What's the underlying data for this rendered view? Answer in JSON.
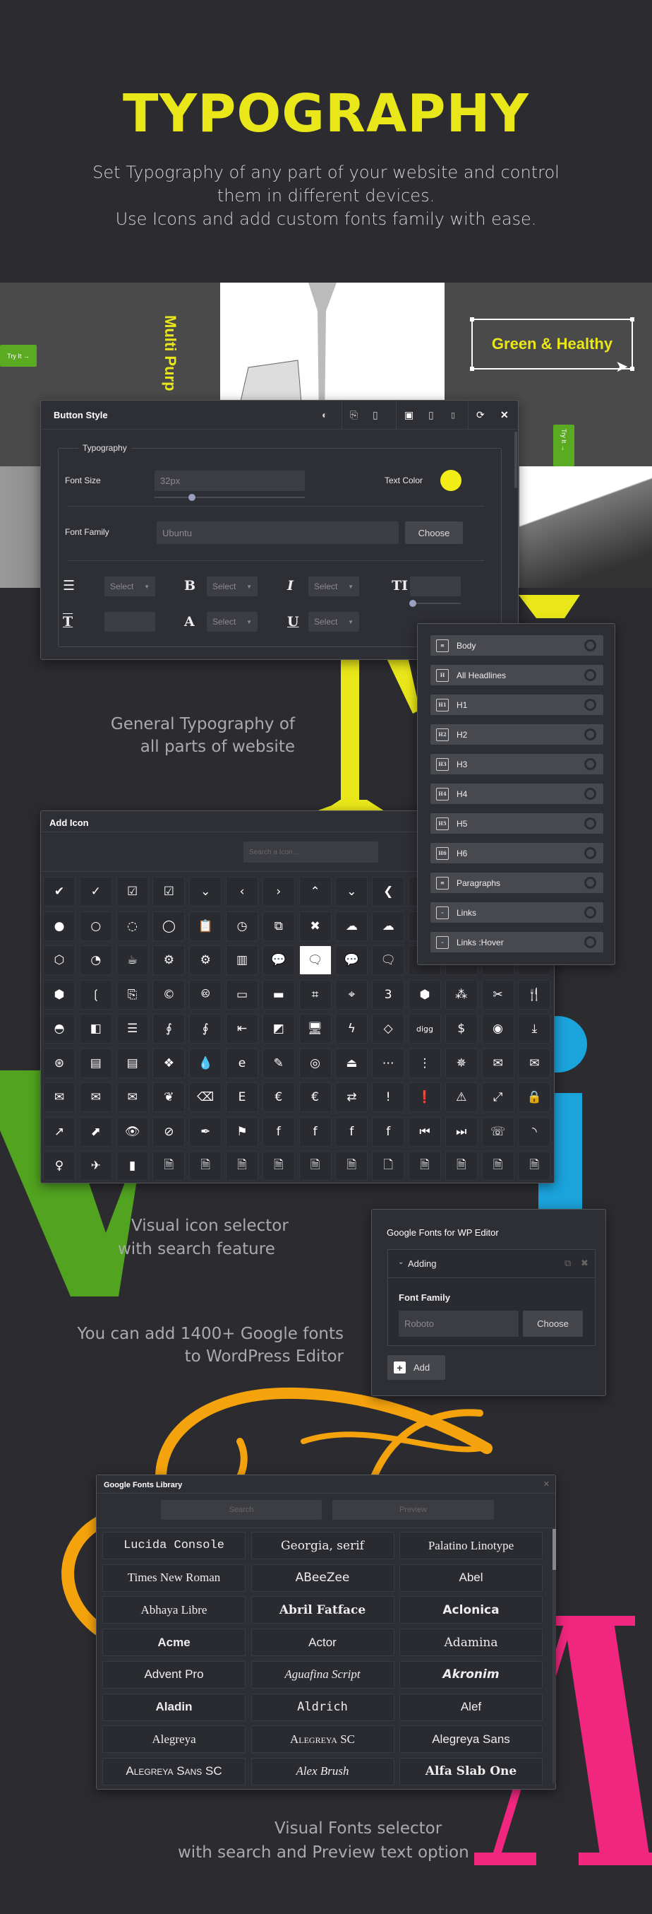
{
  "header": {
    "title": "TYPOGRAPHY",
    "subtitle_lines": [
      "Set Typography of any part of your website and control",
      "them in different devices.",
      "Use Icons and add custom fonts family with ease."
    ]
  },
  "colors": {
    "accent_yellow": "#e9e71a",
    "green": "#5aaa22",
    "blue": "#1ba3dc",
    "orange": "#f5a30d",
    "pink": "#f0267f",
    "background": "#2b2b30"
  },
  "hero": {
    "try_it_left": "Try It →",
    "vertical_text": "Multi Purp",
    "selected_text": "Green & Healthy",
    "try_it_vertical": "Try It →"
  },
  "button_style": {
    "title": "Button Style",
    "header_icons": [
      "contrast-icon",
      "copy-icon",
      "paste-icon",
      "desktop-icon",
      "tablet-icon",
      "mobile-icon",
      "refresh-icon",
      "close-icon"
    ],
    "fieldset_legend": "Typography",
    "font_size_label": "Font Size",
    "font_size_value": "32px",
    "font_size_slider": 0.25,
    "text_color_label": "Text Color",
    "text_color": "#f2ec17",
    "font_family_label": "Font Family",
    "font_family_value": "Ubuntu",
    "choose_label": "Choose",
    "row1": [
      {
        "icon": "line-height-icon",
        "value": "Select"
      },
      {
        "icon": "bold-icon",
        "value": "Select"
      },
      {
        "icon": "italic-icon",
        "value": "Select"
      },
      {
        "icon": "text-height-icon",
        "value": ""
      }
    ],
    "row2": [
      {
        "icon": "letter-spacing-icon",
        "value": ""
      },
      {
        "icon": "font-color-icon",
        "value": "Select"
      },
      {
        "icon": "underline-icon",
        "value": "Select"
      }
    ],
    "letter_slider": 0.05
  },
  "typography_list": {
    "items": [
      {
        "label": "Body",
        "icon": "body"
      },
      {
        "label": "All Headlines",
        "icon": "H"
      },
      {
        "label": "H1",
        "icon": "H1"
      },
      {
        "label": "H2",
        "icon": "H2"
      },
      {
        "label": "H3",
        "icon": "H3"
      },
      {
        "label": "H4",
        "icon": "H4"
      },
      {
        "label": "H5",
        "icon": "H5"
      },
      {
        "label": "H6",
        "icon": "H6"
      },
      {
        "label": "Paragraphs",
        "icon": "paragraph"
      },
      {
        "label": "Links",
        "icon": "link"
      },
      {
        "label": "Links :Hover",
        "icon": "link"
      }
    ]
  },
  "captions": {
    "general": [
      "General Typography of",
      "all parts of website"
    ],
    "icon": [
      "Visual icon selector",
      "with search feature"
    ],
    "google": [
      "You can add 1400+ Google fonts",
      "to WordPress Editor"
    ],
    "fonts": [
      "Visual Fonts selector",
      "with search and Preview text option"
    ]
  },
  "icon_selector": {
    "title": "Add Icon",
    "search_placeholder": "Search a Icon...",
    "selected_index": 35,
    "icons": [
      "check-circle",
      "check-circle-o",
      "check-square",
      "check-square-o",
      "chevron-circle-down",
      "chevron-circle-left",
      "chevron-circle-right",
      "chevron-circle-up",
      "chevron-down",
      "chevron-left",
      "",
      "",
      "",
      "",
      "circle",
      "circle-o",
      "circle-o-notch",
      "circle-thin",
      "clipboard",
      "clock-o",
      "clone",
      "close",
      "cloud",
      "cloud-download",
      "",
      "",
      "",
      "",
      "codepen",
      "codiepie",
      "coffee",
      "cog",
      "cogs",
      "columns",
      "comment",
      "comment-o",
      "commenting",
      "commenting-o",
      "",
      "",
      "",
      "",
      "connectdevelop",
      "contao",
      "copy",
      "copyright",
      "creative-commons",
      "credit-card",
      "credit-card-alt",
      "crop",
      "crosshairs",
      "css3",
      "cube",
      "cubes",
      "cut",
      "cutlery",
      "dashboard",
      "dashcube",
      "database",
      "deaf",
      "deafness",
      "dedent",
      "delicious",
      "desktop",
      "deviantart",
      "diamond",
      "digg",
      "dollar",
      "dot-circle-o",
      "download",
      "dribbble",
      "drivers-license",
      "drivers-license-o",
      "dropbox",
      "drupal",
      "edge",
      "edit",
      "eercast",
      "eject",
      "ellipsis-h",
      "ellipsis-v",
      "empire",
      "envelope",
      "envelope-o",
      "envelope-open",
      "envelope-open-o",
      "envelope-square",
      "envira",
      "eraser",
      "etsy",
      "eur",
      "euro",
      "exchange",
      "exclamation",
      "exclamation-circle",
      "exclamation-triangle",
      "expand",
      "expeditedssl",
      "external-link",
      "external-link-square",
      "eye",
      "eye-slash",
      "eyedropper",
      "flag",
      "facebook",
      "facebook-f",
      "facebook-official",
      "facebook-square",
      "fast-backward",
      "fast-forward",
      "fax",
      "feed",
      "female",
      "fighter-jet",
      "file",
      "file-archive-o",
      "file-audio-o",
      "file-code-o",
      "file-excel-o",
      "file-image-o",
      "file-movie-o",
      "file-o",
      "file-pdf-o",
      "file-photo-o",
      "file-picture-o",
      "file-powerpoint-o"
    ]
  },
  "google_fonts_editor": {
    "title": "Google Fonts for WP Editor",
    "section": "Adding",
    "font_family_label": "Font Family",
    "font_family_value": "Roboto",
    "choose_label": "Choose",
    "add_label": "Add"
  },
  "fonts_library": {
    "title": "Google Fonts Library",
    "search_placeholder": "Search",
    "preview_placeholder": "Preview",
    "fonts": [
      "Lucida Console",
      "Georgia, serif",
      "Palatino Linotype",
      "Times New Roman",
      "ABeeZee",
      "Abel",
      "Abhaya Libre",
      "Abril Fatface",
      "Aclonica",
      "Acme",
      "Actor",
      "Adamina",
      "Advent Pro",
      "Aguafina Script",
      "Akronim",
      "Aladin",
      "Aldrich",
      "Alef",
      "Alegreya",
      "Alegreya SC",
      "Alegreya Sans",
      "Alegreya Sans SC",
      "Alex Brush",
      "Alfa Slab One"
    ]
  }
}
